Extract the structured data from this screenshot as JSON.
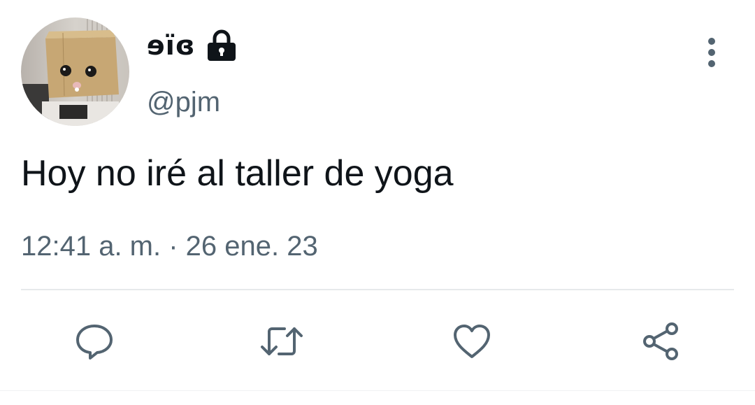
{
  "tweet": {
    "display_name": "ɘïɞ",
    "handle": "@pjm",
    "text": "Hoy no iré al taller de yoga",
    "timestamp": "12:41 a. m. · 26 ene. 23",
    "account_protected": true
  },
  "icons": {
    "lock": "lock-icon",
    "more": "more-vertical-icon",
    "reply": "reply-icon",
    "retweet": "retweet-icon",
    "like": "heart-icon",
    "share": "share-icon"
  },
  "colors": {
    "primary_text": "#0f1419",
    "secondary_text": "#536471",
    "divider": "#e6e9eb",
    "background": "#ffffff"
  }
}
